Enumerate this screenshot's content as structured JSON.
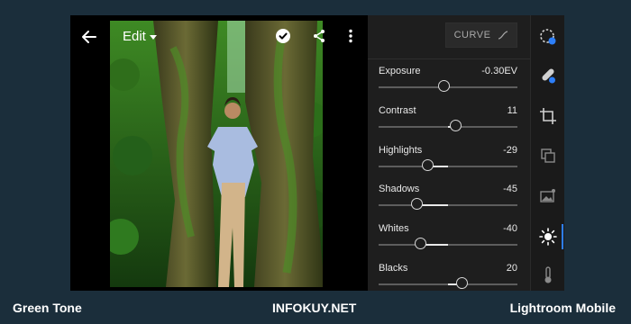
{
  "topbar": {
    "edit_label": "Edit"
  },
  "panel": {
    "curve_label": "CURVE",
    "sliders": [
      {
        "label": "Exposure",
        "value_text": "-0.30EV",
        "value": -0.3,
        "range": [
          -5,
          5
        ]
      },
      {
        "label": "Contrast",
        "value_text": "11",
        "value": 11,
        "range": [
          -100,
          100
        ]
      },
      {
        "label": "Highlights",
        "value_text": "-29",
        "value": -29,
        "range": [
          -100,
          100
        ]
      },
      {
        "label": "Shadows",
        "value_text": "-45",
        "value": -45,
        "range": [
          -100,
          100
        ]
      },
      {
        "label": "Whites",
        "value_text": "-40",
        "value": -40,
        "range": [
          -100,
          100
        ]
      },
      {
        "label": "Blacks",
        "value_text": "20",
        "value": 20,
        "range": [
          -100,
          100
        ]
      }
    ]
  },
  "tools": [
    "auto-icon",
    "healing-icon",
    "crop-icon",
    "presets-icon",
    "selective-icon",
    "light-icon",
    "color-icon"
  ],
  "active_tool": "light-icon",
  "captions": {
    "left": "Green Tone",
    "center": "INFOKUY.NET",
    "right": "Lightroom Mobile"
  },
  "colors": {
    "accent": "#2d7ff9",
    "panel_bg": "#1e1e1e",
    "page_bg": "#1b2e3b"
  }
}
